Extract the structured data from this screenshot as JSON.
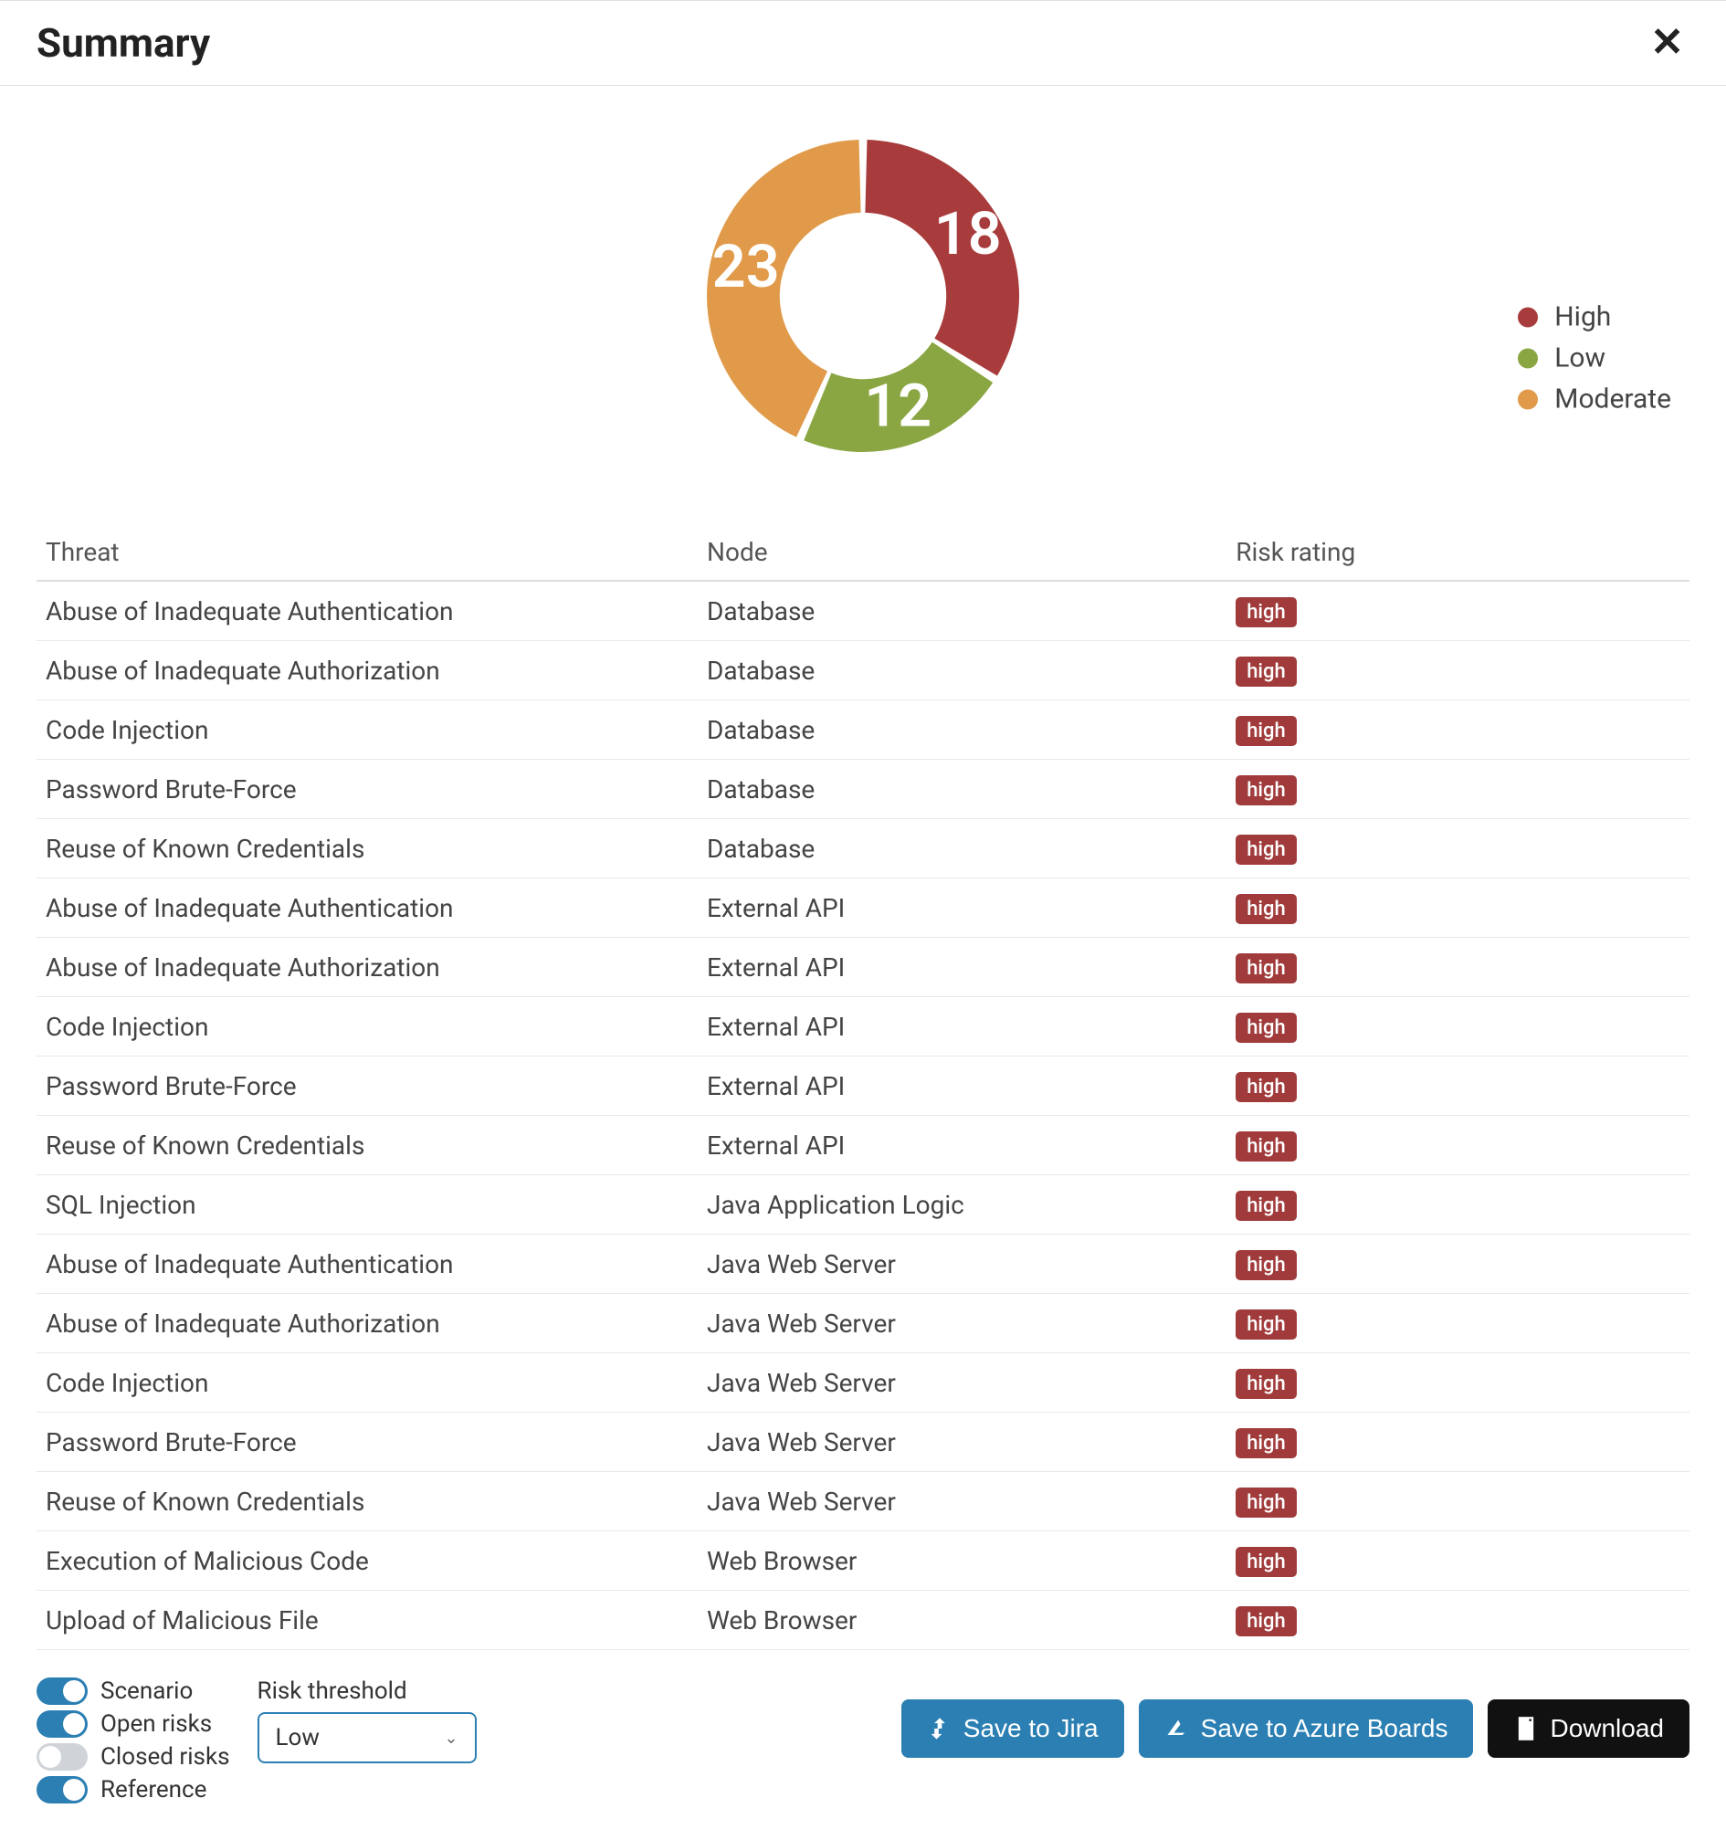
{
  "header": {
    "title": "Summary"
  },
  "chart_data": {
    "type": "pie",
    "title": "",
    "series": [
      {
        "name": "High",
        "value": 18,
        "color": "#a83b3b"
      },
      {
        "name": "Moderate",
        "value": 23,
        "color": "#e09a4a"
      },
      {
        "name": "Low",
        "value": 12,
        "color": "#8aa642"
      }
    ],
    "donut": true,
    "legend_position": "right"
  },
  "table": {
    "columns": [
      "Threat",
      "Node",
      "Risk rating"
    ],
    "rows": [
      {
        "threat": "Abuse of Inadequate Authentication",
        "node": "Database",
        "rating": "high"
      },
      {
        "threat": "Abuse of Inadequate Authorization",
        "node": "Database",
        "rating": "high"
      },
      {
        "threat": "Code Injection",
        "node": "Database",
        "rating": "high"
      },
      {
        "threat": "Password Brute-Force",
        "node": "Database",
        "rating": "high"
      },
      {
        "threat": "Reuse of Known Credentials",
        "node": "Database",
        "rating": "high"
      },
      {
        "threat": "Abuse of Inadequate Authentication",
        "node": "External API",
        "rating": "high"
      },
      {
        "threat": "Abuse of Inadequate Authorization",
        "node": "External API",
        "rating": "high"
      },
      {
        "threat": "Code Injection",
        "node": "External API",
        "rating": "high"
      },
      {
        "threat": "Password Brute-Force",
        "node": "External API",
        "rating": "high"
      },
      {
        "threat": "Reuse of Known Credentials",
        "node": "External API",
        "rating": "high"
      },
      {
        "threat": "SQL Injection",
        "node": "Java Application Logic",
        "rating": "high"
      },
      {
        "threat": "Abuse of Inadequate Authentication",
        "node": "Java Web Server",
        "rating": "high"
      },
      {
        "threat": "Abuse of Inadequate Authorization",
        "node": "Java Web Server",
        "rating": "high"
      },
      {
        "threat": "Code Injection",
        "node": "Java Web Server",
        "rating": "high"
      },
      {
        "threat": "Password Brute-Force",
        "node": "Java Web Server",
        "rating": "high"
      },
      {
        "threat": "Reuse of Known Credentials",
        "node": "Java Web Server",
        "rating": "high"
      },
      {
        "threat": "Execution of Malicious Code",
        "node": "Web Browser",
        "rating": "high"
      },
      {
        "threat": "Upload of Malicious File",
        "node": "Web Browser",
        "rating": "high"
      }
    ]
  },
  "footer": {
    "toggles": [
      {
        "key": "scenario",
        "label": "Scenario",
        "on": true
      },
      {
        "key": "open_risks",
        "label": "Open risks",
        "on": true
      },
      {
        "key": "closed_risks",
        "label": "Closed risks",
        "on": false
      },
      {
        "key": "reference",
        "label": "Reference",
        "on": true
      }
    ],
    "threshold": {
      "label": "Risk threshold",
      "selected": "Low"
    },
    "actions": {
      "save_jira": "Save to Jira",
      "save_azure": "Save to Azure Boards",
      "download": "Download"
    }
  },
  "colors": {
    "high": "#a83b3b",
    "low": "#8aa642",
    "moderate": "#e09a4a",
    "primary": "#2b7fb3",
    "badge_bg": "#a13b3b"
  }
}
